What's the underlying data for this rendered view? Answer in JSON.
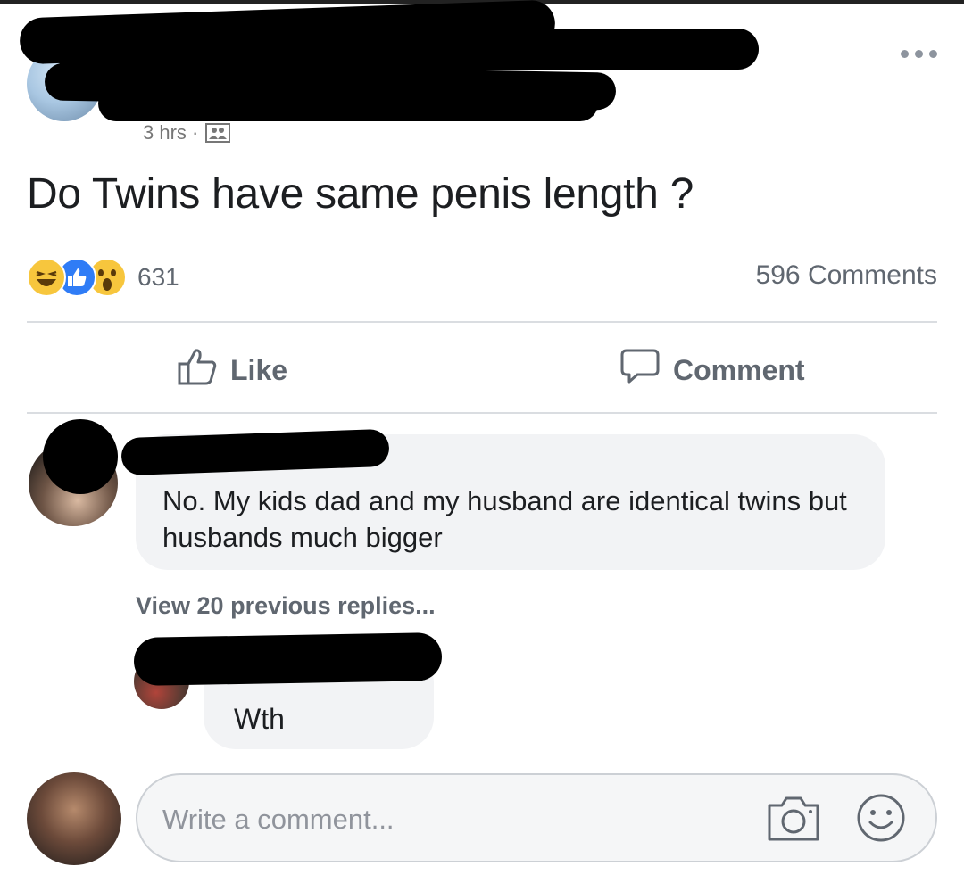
{
  "post": {
    "timestamp": "3 hrs ·",
    "text": "Do Twins have same penis length ?",
    "reaction_count": "631",
    "comments_count": "596 Comments",
    "reactions": [
      "haha",
      "like",
      "wow"
    ]
  },
  "actions": {
    "like_label": "Like",
    "comment_label": "Comment"
  },
  "comments": [
    {
      "text": "No. My kids dad and my husband are identical twins but husbands much bigger"
    }
  ],
  "view_replies": "View 20 previous replies...",
  "replies": [
    {
      "text": "Wth"
    }
  ],
  "composer": {
    "placeholder": "Write a comment..."
  },
  "colors": {
    "like_blue": "#2f7cf6",
    "reaction_yellow": "#f7c63d",
    "secondary_text": "#606770",
    "bubble_bg": "#f2f3f5"
  },
  "icons": [
    "more-icon",
    "audience-icon",
    "haha-icon",
    "like-reaction-icon",
    "wow-icon",
    "thumbs-up-icon",
    "comment-icon",
    "camera-icon",
    "emoji-icon"
  ]
}
